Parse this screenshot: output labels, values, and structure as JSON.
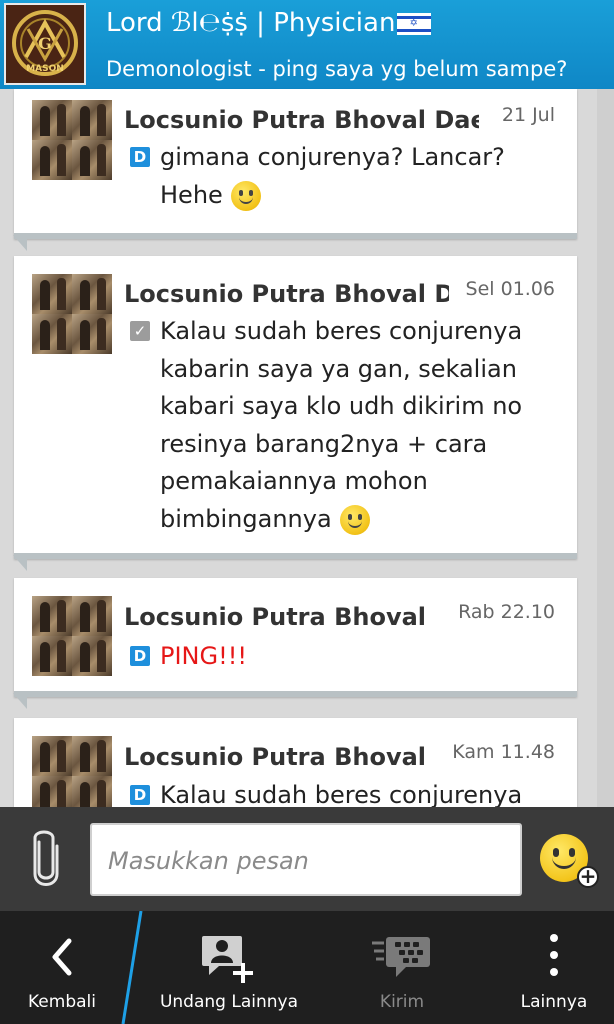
{
  "header": {
    "name": "Lord ℬl℮ṩṩ | Physician",
    "status": "Demonologist - ping saya yg belum sampe?",
    "avatar_icon": "masonic-emblem-icon",
    "flag_icon": "israel-flag-icon"
  },
  "messages": [
    {
      "sender": "Locsunio Putra Bhoval Dae",
      "time": "21 Jul",
      "status_icon": "D",
      "lines": [
        "gimana conjurenya? Lancar?",
        "Hehe"
      ],
      "smiley": true
    },
    {
      "sender": "Locsunio Putra Bhoval D",
      "time": "Sel 01.06",
      "status_icon": "read-check-icon",
      "lines": [
        "Kalau sudah beres conjurenya",
        "kabarin saya ya gan, sekalian",
        "kabari saya klo udh dikirim no",
        "resinya barang2nya + cara",
        "pemakaiannya mohon",
        "bimbingannya"
      ],
      "smiley": true
    },
    {
      "sender": "Locsunio Putra Bhoval",
      "time": "Rab 22.10",
      "status_icon": "D",
      "lines": [
        "PING!!!"
      ],
      "smiley": false
    },
    {
      "sender": "Locsunio Putra Bhoval",
      "time": "Kam 11.48",
      "status_icon": "D",
      "lines": [
        "Kalau sudah beres conjurenya"
      ],
      "smiley": false
    }
  ],
  "composer": {
    "placeholder": "Masukkan pesan",
    "attach_icon": "paperclip-icon",
    "emoji_icon": "smiley-add-icon"
  },
  "actions": {
    "back": "Kembali",
    "invite": "Undang Lainnya",
    "send": "Kirim",
    "more": "Lainnya"
  },
  "colors": {
    "header": "#1195d3",
    "accent": "#1e8fdc",
    "ping": "#e61717",
    "actionbar": "#1f1f1f"
  }
}
